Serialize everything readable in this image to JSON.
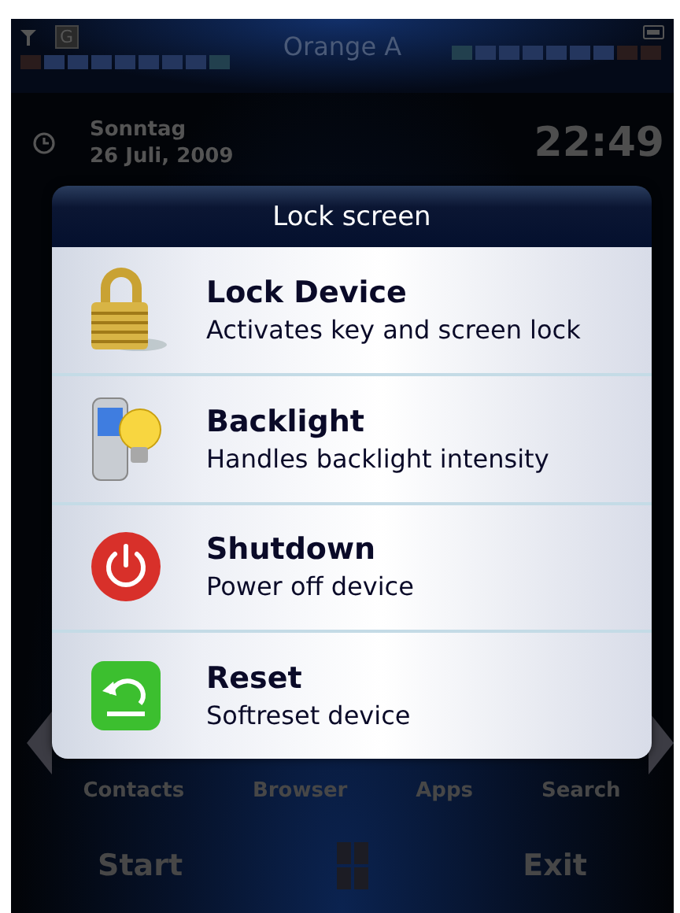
{
  "status_bar": {
    "operator": "Orange A",
    "network_type": "G"
  },
  "today": {
    "day": "Sonntag",
    "date": "26 Juli, 2009",
    "time": "22:49"
  },
  "dialog": {
    "title": "Lock screen",
    "items": [
      {
        "kind": "lock",
        "title": "Lock Device",
        "description": "Activates key and screen lock"
      },
      {
        "kind": "backlight",
        "title": "Backlight",
        "description": "Handles backlight intensity"
      },
      {
        "kind": "power",
        "title": "Shutdown",
        "description": "Power off device"
      },
      {
        "kind": "reset",
        "title": "Reset",
        "description": "Softreset device"
      }
    ]
  },
  "nav": [
    "Contacts",
    "Browser",
    "Apps",
    "Search"
  ],
  "softkeys": {
    "left": "Start",
    "right": "Exit"
  }
}
